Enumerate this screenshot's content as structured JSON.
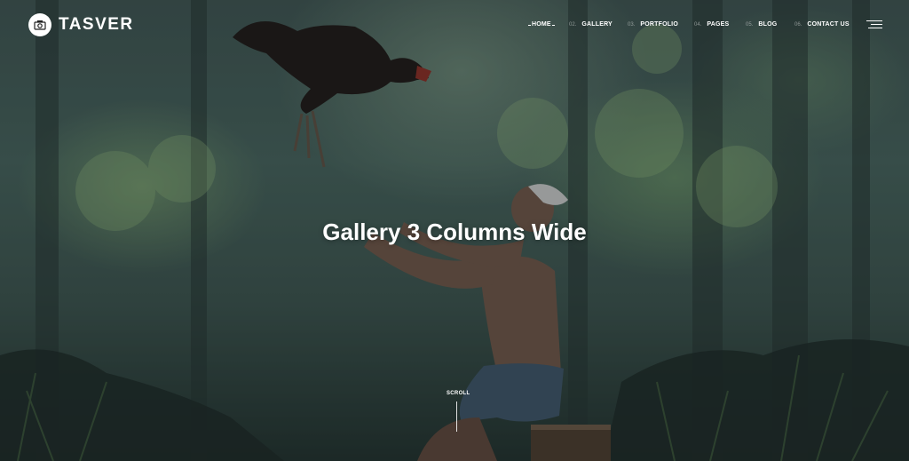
{
  "brand": {
    "name": "TASVER",
    "logo_icon": "camera-icon"
  },
  "nav": {
    "items": [
      {
        "num": "",
        "label": "HOME"
      },
      {
        "num": "02.",
        "label": "GALLERY"
      },
      {
        "num": "03.",
        "label": "PORTFOLIO"
      },
      {
        "num": "04.",
        "label": "PAGES"
      },
      {
        "num": "05.",
        "label": "BLOG"
      },
      {
        "num": "06.",
        "label": "CONTACT US"
      }
    ],
    "menu_icon": "hamburger-menu-icon"
  },
  "hero": {
    "title": "Gallery 3 Columns Wide",
    "scroll_label": "SCROLL"
  }
}
